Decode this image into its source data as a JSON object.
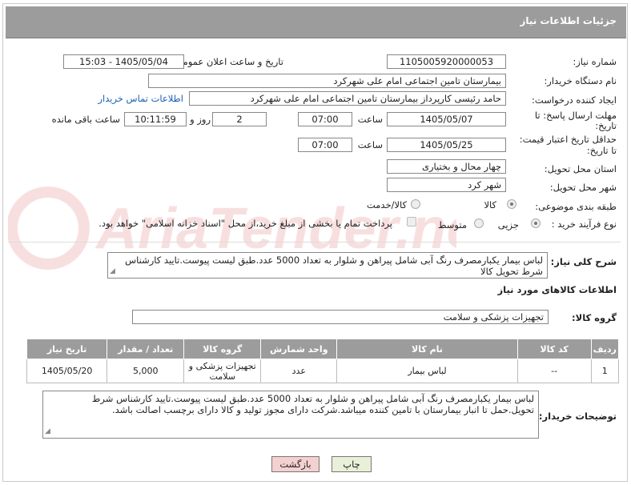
{
  "header": {
    "title": "جزئیات اطلاعات نیاز"
  },
  "fields": {
    "need_number_label": "شماره نیاز:",
    "need_number": "1105005920000053",
    "announce_label": "تاریخ و ساعت اعلان عمومی:",
    "announce_value": "1405/05/04 - 15:03",
    "buyer_label": "نام دستگاه خریدار:",
    "buyer_value": "بیمارستان تامین اجتماعی امام علی شهرکرد",
    "creator_label": "ایجاد کننده درخواست:",
    "creator_value": "حامد رئیسی کارپرداز بیمارستان تامین اجتماعی امام علی شهرکرد",
    "contact_link": "اطلاعات تماس خریدار",
    "deadline_label_1": "مهلت ارسال پاسخ: تا",
    "deadline_label_2": "تاریخ:",
    "deadline_date": "1405/05/07",
    "time_label": "ساعت",
    "deadline_time": "07:00",
    "days_value": "2",
    "days_label": "روز و",
    "remaining_time": "10:11:59",
    "remaining_label": "ساعت باقی مانده",
    "min_price_label_1": "حداقل تاریخ اعتبار قیمت:",
    "min_price_label_2": "تا تاریخ:",
    "min_price_date": "1405/05/25",
    "min_price_time": "07:00",
    "province_label": "استان محل تحویل:",
    "province_value": "چهار محال و بختیاری",
    "city_label": "شهر محل تحویل:",
    "city_value": "شهر کرد",
    "category_label": "طبقه بندی موضوعی:",
    "category_goods": "کالا",
    "category_service": "کالا/خدمت",
    "process_label": "نوع فرآیند خرید :",
    "process_partial": "جزیی",
    "process_medium": "متوسط",
    "payment_text": "پرداخت تمام یا بخشی از مبلغ خرید،از محل \"اسناد خزانه اسلامی\" خواهد بود."
  },
  "description": {
    "label": "شرح کلی نیاز:",
    "text": "لباس بیمار یکبارمصرف رنگ آبی شامل پیراهن و شلوار به تعداد 5000 عدد.طبق لیست پیوست.تایید کارشناس شرط تحویل کالا"
  },
  "goods_info": {
    "title": "اطلاعات کالاهای مورد نیاز",
    "group_label": "گروه کالا:",
    "group_value": "تجهیزات پزشکی و سلامت"
  },
  "table": {
    "headers": [
      "ردیف",
      "کد کالا",
      "نام کالا",
      "واحد شمارش",
      "گروه کالا",
      "تعداد / مقدار",
      "تاریخ نیاز"
    ],
    "rows": [
      [
        "1",
        "--",
        "لباس بیمار",
        "عدد",
        "تجهیزات پزشکی و سلامت",
        "5,000",
        "1405/05/20"
      ]
    ]
  },
  "buyer_notes": {
    "label": "توضیحات خریدار:",
    "text": "لباس بیمار یکبارمصرف رنگ آبی شامل پیراهن و شلوار به تعداد 5000 عدد.طبق لیست پیوست.تایید کارشناس شرط تحویل.حمل تا انبار بیمارستان با تامین کننده میباشد.شرکت دارای مجوز تولید و کالا دارای برچسب اصالت باشد."
  },
  "buttons": {
    "print": "چاپ",
    "back": "بازگشت"
  },
  "colors": {
    "header_bg": "#9c9c9c",
    "link": "#1a5fb4",
    "back_btn": "#f5d0d0",
    "print_btn": "#e8f0d8"
  }
}
